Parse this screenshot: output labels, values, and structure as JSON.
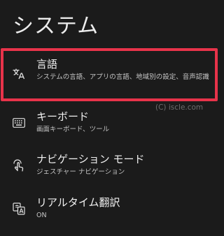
{
  "header": {
    "title": "システム"
  },
  "items": [
    {
      "title": "言語",
      "summary": "システムの言語、アプリの言語、地域別の設定、音声認識",
      "icon": "translate-icon"
    },
    {
      "title": "キーボード",
      "summary": "画面キーボード、ツール",
      "icon": "keyboard-icon"
    },
    {
      "title": "ナビゲーション モード",
      "summary": "ジェスチャー ナビゲーション",
      "icon": "gesture-navigation-icon"
    },
    {
      "title": "リアルタイム翻訳",
      "summary": "ON",
      "icon": "live-translate-icon"
    }
  ],
  "watermark": "(C) iscle.com",
  "colors": {
    "background": "#1b1b1b",
    "highlight_border": "#e8334a",
    "title_text": "#f0f0f0",
    "summary_text": "#c4c4c4"
  }
}
